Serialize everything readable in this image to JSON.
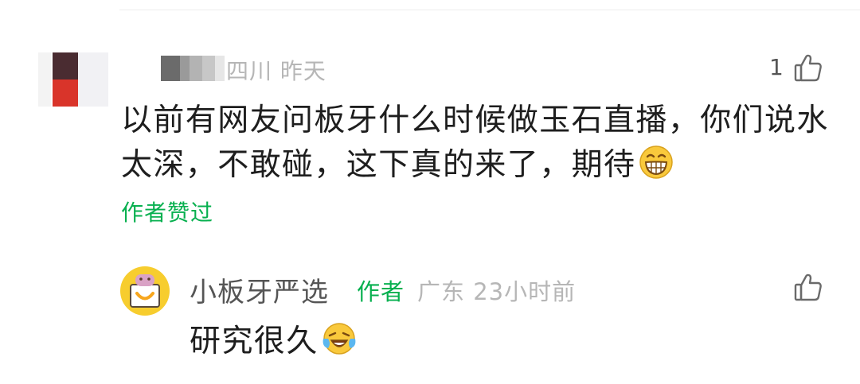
{
  "comment": {
    "location": "四川",
    "time": "昨天",
    "like_count": "1",
    "text": "以前有网友问板牙什么时候做玉石直播，你们说水太深，不敢碰，这下真的来了，期待",
    "emoji": "grinning-face",
    "author_liked_label": "作者赞过"
  },
  "reply": {
    "name": "小板牙严选",
    "author_tag": "作者",
    "location": "广东",
    "time": "23小时前",
    "text": "研究很久",
    "emoji": "loudly-crying-laughing-face"
  },
  "colors": {
    "green": "#07b04f",
    "meta_gray": "#b6b6b6",
    "text": "#1e1e1e",
    "avatar_yellow": "#f7cd2e"
  }
}
